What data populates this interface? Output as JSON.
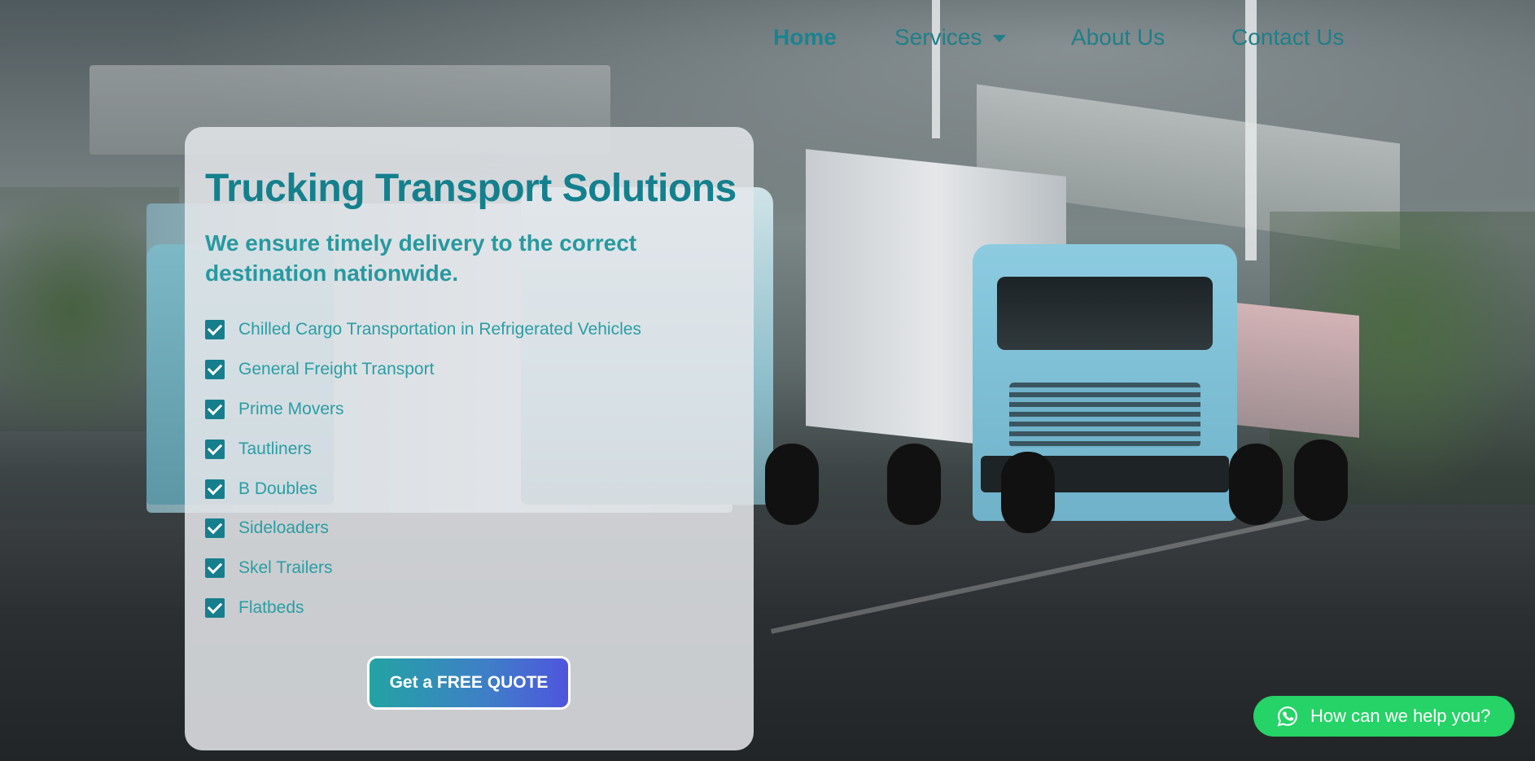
{
  "nav": {
    "items": [
      {
        "label": "Home"
      },
      {
        "label": "Services",
        "has_dropdown": true
      },
      {
        "label": "About Us"
      },
      {
        "label": "Contact Us"
      }
    ]
  },
  "hero": {
    "title": "Trucking Transport Solutions",
    "subtitle": "We ensure timely delivery to the correct destination nationwide.",
    "features": [
      "Chilled Cargo Transportation in Refrigerated Vehicles",
      "General Freight Transport",
      "Prime Movers",
      "Tautliners",
      "B Doubles",
      "Sideloaders",
      "Skel Trailers",
      "Flatbeds"
    ],
    "cta_label": "Get a FREE QUOTE"
  },
  "chat": {
    "label": "How can we help you?",
    "icon": "whatsapp-icon"
  },
  "colors": {
    "brand_teal": "#14808d",
    "feature_text": "#2a9ea4",
    "whatsapp_green": "#25d366"
  }
}
